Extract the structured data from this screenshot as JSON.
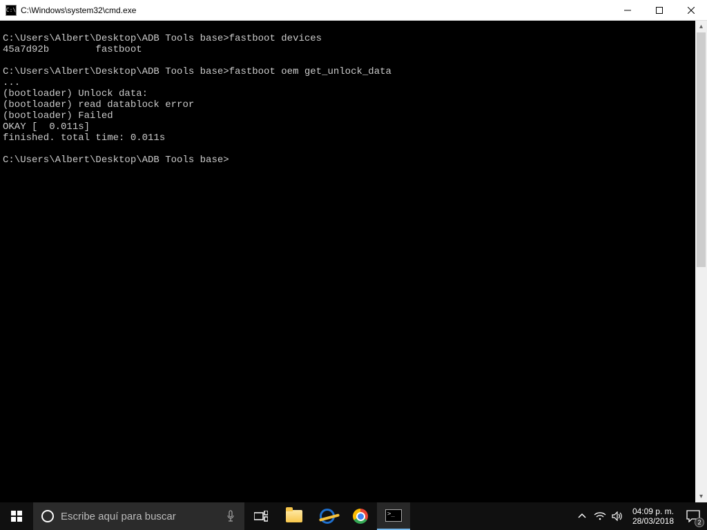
{
  "window": {
    "title": "C:\\Windows\\system32\\cmd.exe",
    "icon_text": "C:\\"
  },
  "terminal": {
    "lines": [
      "",
      "C:\\Users\\Albert\\Desktop\\ADB Tools base>fastboot devices",
      "45a7d92b        fastboot",
      "",
      "C:\\Users\\Albert\\Desktop\\ADB Tools base>fastboot oem get_unlock_data",
      "...",
      "(bootloader) Unlock data:",
      "(bootloader) read datablock error",
      "(bootloader) Failed",
      "OKAY [  0.011s]",
      "finished. total time: 0.011s",
      "",
      "C:\\Users\\Albert\\Desktop\\ADB Tools base>"
    ]
  },
  "taskbar": {
    "search_placeholder": "Escribe aquí para buscar",
    "time": "04:09 p. m.",
    "date": "28/03/2018",
    "notification_count": "2"
  }
}
